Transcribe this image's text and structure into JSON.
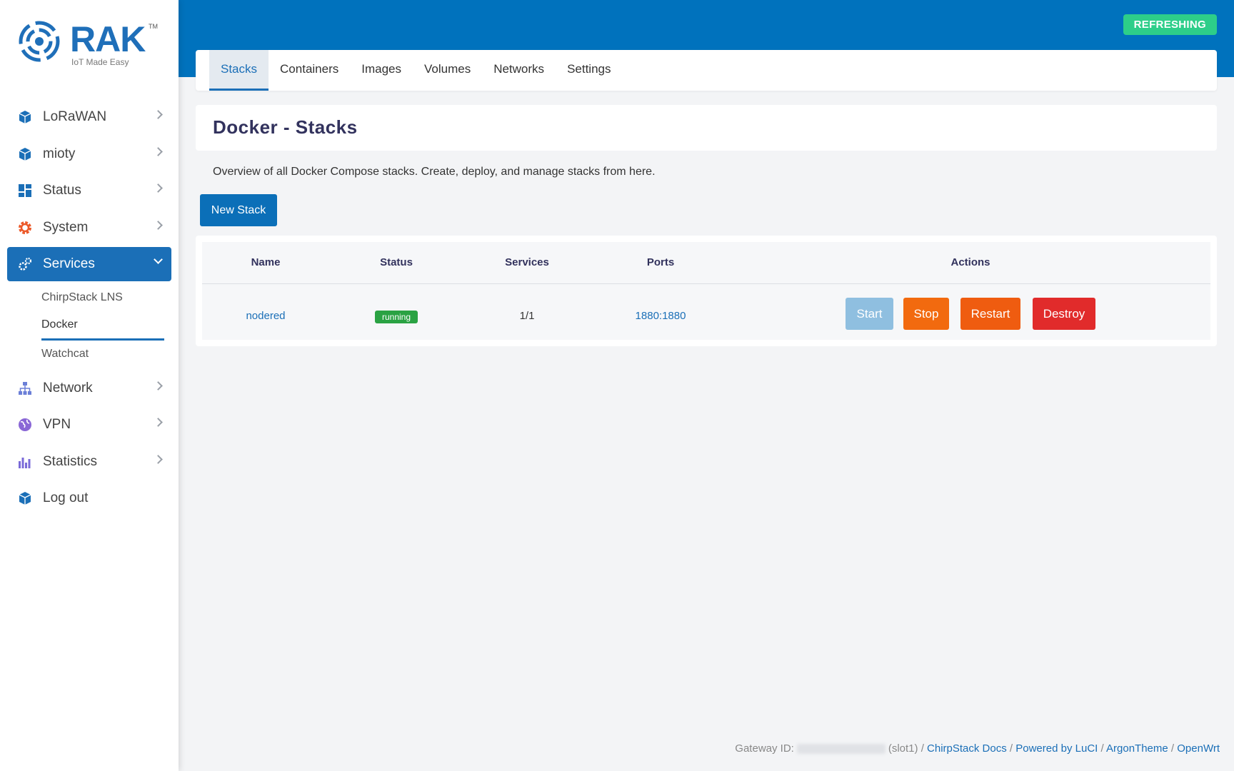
{
  "brand": {
    "name": "RAK",
    "trademark": "TM",
    "tagline": "IoT Made Easy"
  },
  "header": {
    "status_badge": "REFRESHING"
  },
  "sidebar": {
    "items": [
      {
        "label": "LoRaWAN",
        "icon": "cube-icon"
      },
      {
        "label": "mioty",
        "icon": "cube-icon"
      },
      {
        "label": "Status",
        "icon": "dashboard-icon"
      },
      {
        "label": "System",
        "icon": "gear-icon"
      },
      {
        "label": "Services",
        "icon": "cogs-icon",
        "active": true
      },
      {
        "label": "Network",
        "icon": "network-icon"
      },
      {
        "label": "VPN",
        "icon": "globe-icon"
      },
      {
        "label": "Statistics",
        "icon": "bar-chart-icon"
      },
      {
        "label": "Log out",
        "icon": "cube-icon"
      }
    ],
    "services_sub": [
      "ChirpStack LNS",
      "Docker",
      "Watchcat"
    ],
    "current_sub": "Docker"
  },
  "tabs": [
    "Stacks",
    "Containers",
    "Images",
    "Volumes",
    "Networks",
    "Settings"
  ],
  "active_tab": "Stacks",
  "page": {
    "title": "Docker - Stacks",
    "description": "Overview of all Docker Compose stacks. Create, deploy, and manage stacks from here.",
    "new_button": "New Stack"
  },
  "table": {
    "headers": [
      "Name",
      "Status",
      "Services",
      "Ports",
      "Actions"
    ],
    "rows": [
      {
        "name": "nodered",
        "status": "running",
        "services": "1/1",
        "ports": "1880:1880"
      }
    ],
    "actions": [
      "Start",
      "Stop",
      "Restart",
      "Destroy"
    ]
  },
  "footer": {
    "gateway_label": "Gateway ID:",
    "slot": "(slot1)",
    "sep": "/",
    "links": [
      "ChirpStack Docs",
      "Powered by LuCI",
      "ArgonTheme",
      "OpenWrt"
    ]
  },
  "colors": {
    "primary": "#0072bd",
    "accent": "#1b6fb7",
    "success": "#2dce89",
    "running": "#2aa243",
    "warning": "#f26a0f",
    "danger": "#e12b2b"
  }
}
